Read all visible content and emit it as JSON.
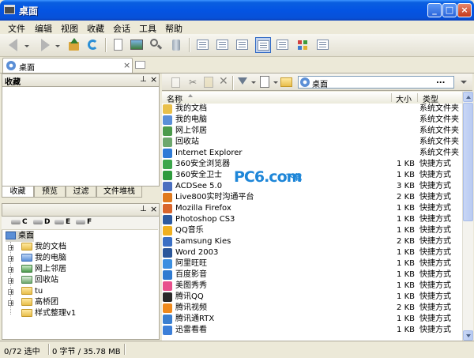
{
  "window": {
    "title": "桌面"
  },
  "menu": [
    "文件",
    "编辑",
    "视图",
    "收藏",
    "会话",
    "工具",
    "帮助"
  ],
  "tab": {
    "label": "桌面",
    "close": "×"
  },
  "favorites": {
    "title": "收藏",
    "pin": "⊥",
    "close": "×",
    "tabs": [
      "收藏",
      "预览",
      "过滤",
      "文件堆栈"
    ]
  },
  "tree": {
    "pin": "⊥",
    "close": "×",
    "drives": [
      "C",
      "D",
      "E",
      "F"
    ],
    "root": "桌面",
    "items": [
      "我的文档",
      "我的电脑",
      "网上邻居",
      "回收站",
      "tu",
      "高桥团",
      "样式整理v1"
    ]
  },
  "address": {
    "value": "桌面",
    "go": "..."
  },
  "columns": {
    "name": "名称",
    "size": "大小",
    "type": "类型"
  },
  "files": [
    {
      "name": "我的文档",
      "size": "",
      "type": "系统文件夹",
      "color": "#E9C04A"
    },
    {
      "name": "我的电脑",
      "size": "",
      "type": "系统文件夹",
      "color": "#5A8FD8"
    },
    {
      "name": "网上邻居",
      "size": "",
      "type": "系统文件夹",
      "color": "#4C9B4C"
    },
    {
      "name": "回收站",
      "size": "",
      "type": "系统文件夹",
      "color": "#6DA86D"
    },
    {
      "name": "Internet Explorer",
      "size": "",
      "type": "系统文件夹",
      "color": "#2E7BD6"
    },
    {
      "name": "360安全浏览器",
      "size": "1 KB",
      "type": "快捷方式",
      "color": "#3CA64B"
    },
    {
      "name": "360安全卫士",
      "size": "1 KB",
      "type": "快捷方式",
      "color": "#2E9B3C"
    },
    {
      "name": "ACDSee 5.0",
      "size": "3 KB",
      "type": "快捷方式",
      "color": "#4A6FBF"
    },
    {
      "name": "Live800实时沟通平台",
      "size": "2 KB",
      "type": "快捷方式",
      "color": "#E07A1E"
    },
    {
      "name": "Mozilla Firefox",
      "size": "1 KB",
      "type": "快捷方式",
      "color": "#D9652B"
    },
    {
      "name": "Photoshop CS3",
      "size": "1 KB",
      "type": "快捷方式",
      "color": "#2C5AA0"
    },
    {
      "name": "QQ音乐",
      "size": "1 KB",
      "type": "快捷方式",
      "color": "#F0B020"
    },
    {
      "name": "Samsung Kies",
      "size": "2 KB",
      "type": "快捷方式",
      "color": "#3A6FC4"
    },
    {
      "name": "Word 2003",
      "size": "1 KB",
      "type": "快捷方式",
      "color": "#2B579A"
    },
    {
      "name": "阿里旺旺",
      "size": "1 KB",
      "type": "快捷方式",
      "color": "#3C8FE0"
    },
    {
      "name": "百度影音",
      "size": "1 KB",
      "type": "快捷方式",
      "color": "#2F7AD0"
    },
    {
      "name": "美图秀秀",
      "size": "1 KB",
      "type": "快捷方式",
      "color": "#E8508C"
    },
    {
      "name": "腾讯QQ",
      "size": "1 KB",
      "type": "快捷方式",
      "color": "#2A2A2A"
    },
    {
      "name": "腾讯视频",
      "size": "2 KB",
      "type": "快捷方式",
      "color": "#F08A1C"
    },
    {
      "name": "腾讯通RTX",
      "size": "1 KB",
      "type": "快捷方式",
      "color": "#3A7FD0"
    },
    {
      "name": "迅雷看看",
      "size": "1 KB",
      "type": "快捷方式",
      "color": "#3C7FD8"
    }
  ],
  "status": {
    "selection": "0/72 选中",
    "bytes": "0 字节 / 35.78 MB"
  },
  "watermark": {
    "main": "PC6.com",
    "tag": "下载"
  }
}
